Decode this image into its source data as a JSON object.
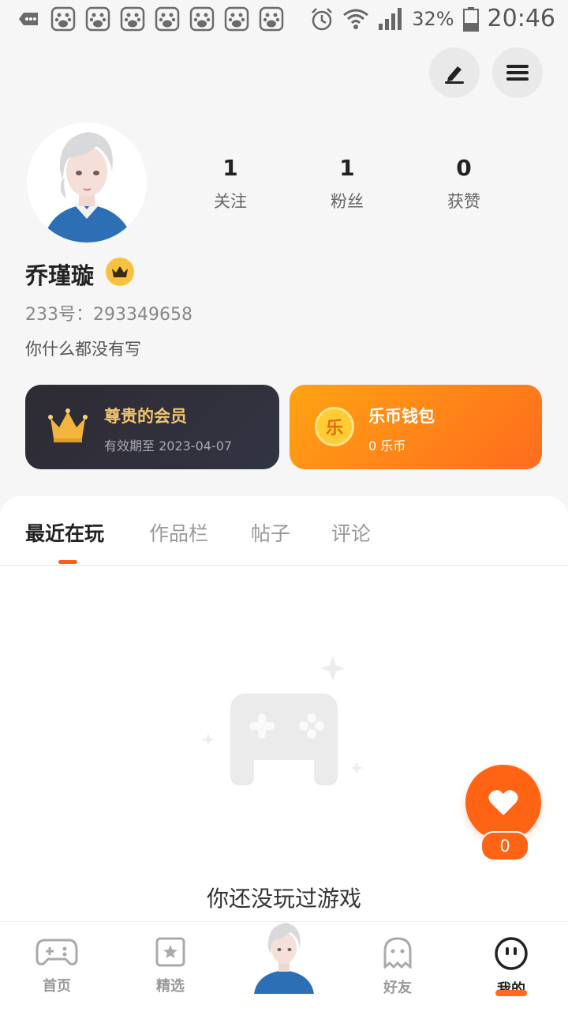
{
  "status_bar": {
    "battery": "32%",
    "time": "20:46",
    "notification_icons": [
      "chat-bubble-icon",
      "baidu-paw-icon",
      "baidu-paw-icon",
      "baidu-paw-icon",
      "baidu-paw-icon",
      "baidu-paw-icon",
      "baidu-paw-icon",
      "baidu-paw-icon"
    ]
  },
  "header": {
    "edit_icon": "pencil-icon",
    "menu_icon": "menu-icon"
  },
  "profile": {
    "name": "乔瑾璇",
    "id_text": "233号：293349658",
    "bio": "你什么都没有写",
    "stats": [
      {
        "value": "1",
        "label": "关注"
      },
      {
        "value": "1",
        "label": "粉丝"
      },
      {
        "value": "0",
        "label": "获赞"
      }
    ]
  },
  "cards": {
    "vip": {
      "title": "尊贵的会员",
      "subtitle": "有效期至 2023-04-07",
      "title_color": "#f2c46d"
    },
    "wallet": {
      "title": "乐币钱包",
      "subtitle": "0 乐币",
      "coin_char": "乐"
    }
  },
  "tabs": [
    {
      "label": "最近在玩",
      "active": true
    },
    {
      "label": "作品栏",
      "active": false
    },
    {
      "label": "帖子",
      "active": false
    },
    {
      "label": "评论",
      "active": false
    }
  ],
  "empty_state": {
    "text": "你还没玩过游戏"
  },
  "like_fab": {
    "count": "0"
  },
  "bottom_nav": [
    {
      "label": "首页",
      "icon": "gamepad-icon",
      "active": false
    },
    {
      "label": "精选",
      "icon": "star-box-icon",
      "active": false
    },
    {
      "label": "",
      "icon": "avatar",
      "active": false
    },
    {
      "label": "好友",
      "icon": "ghost-icon",
      "active": false
    },
    {
      "label": "我的",
      "icon": "face-icon",
      "active": true
    }
  ],
  "colors": {
    "accent": "#ff6314",
    "vip_bg": "#2d2b33",
    "gold": "#f7c240"
  }
}
